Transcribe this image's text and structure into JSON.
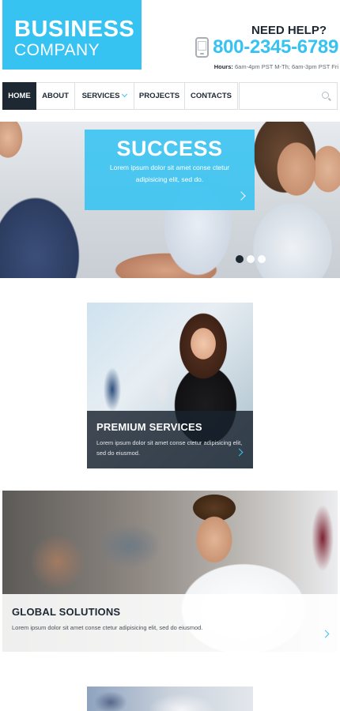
{
  "logo": {
    "line1": "BUSINESS",
    "line2": "COMPANY"
  },
  "contact": {
    "need_help": "NEED HELP?",
    "phone": "800-2345-6789",
    "hours_label": "Hours:",
    "hours_value": "6am-4pm PST M-Th;  6am-3pm PST Fri"
  },
  "nav": {
    "items": [
      {
        "label": "HOME",
        "active": true
      },
      {
        "label": "ABOUT"
      },
      {
        "label": "SERVICES",
        "dropdown": true
      },
      {
        "label": "PROJECTS"
      },
      {
        "label": "CONTACTS"
      }
    ],
    "search_placeholder": ""
  },
  "hero": {
    "title": "SUCCESS",
    "text": "Lorem ipsum dolor sit amet conse ctetur adipisicing elit, sed do.",
    "slides": 3,
    "active_slide": 1
  },
  "cards": [
    {
      "title": "PREMIUM SERVICES",
      "text": "Lorem ipsum dolor sit amet conse ctetur adipisicing elit, sed do eiusmod."
    },
    {
      "title": "GLOBAL SOLUTIONS",
      "text": "Lorem ipsum dolor sit amet conse ctetur adipisicing elit, sed do eiusmod."
    }
  ],
  "colors": {
    "accent": "#36c3f1",
    "dark": "#1e2833"
  }
}
